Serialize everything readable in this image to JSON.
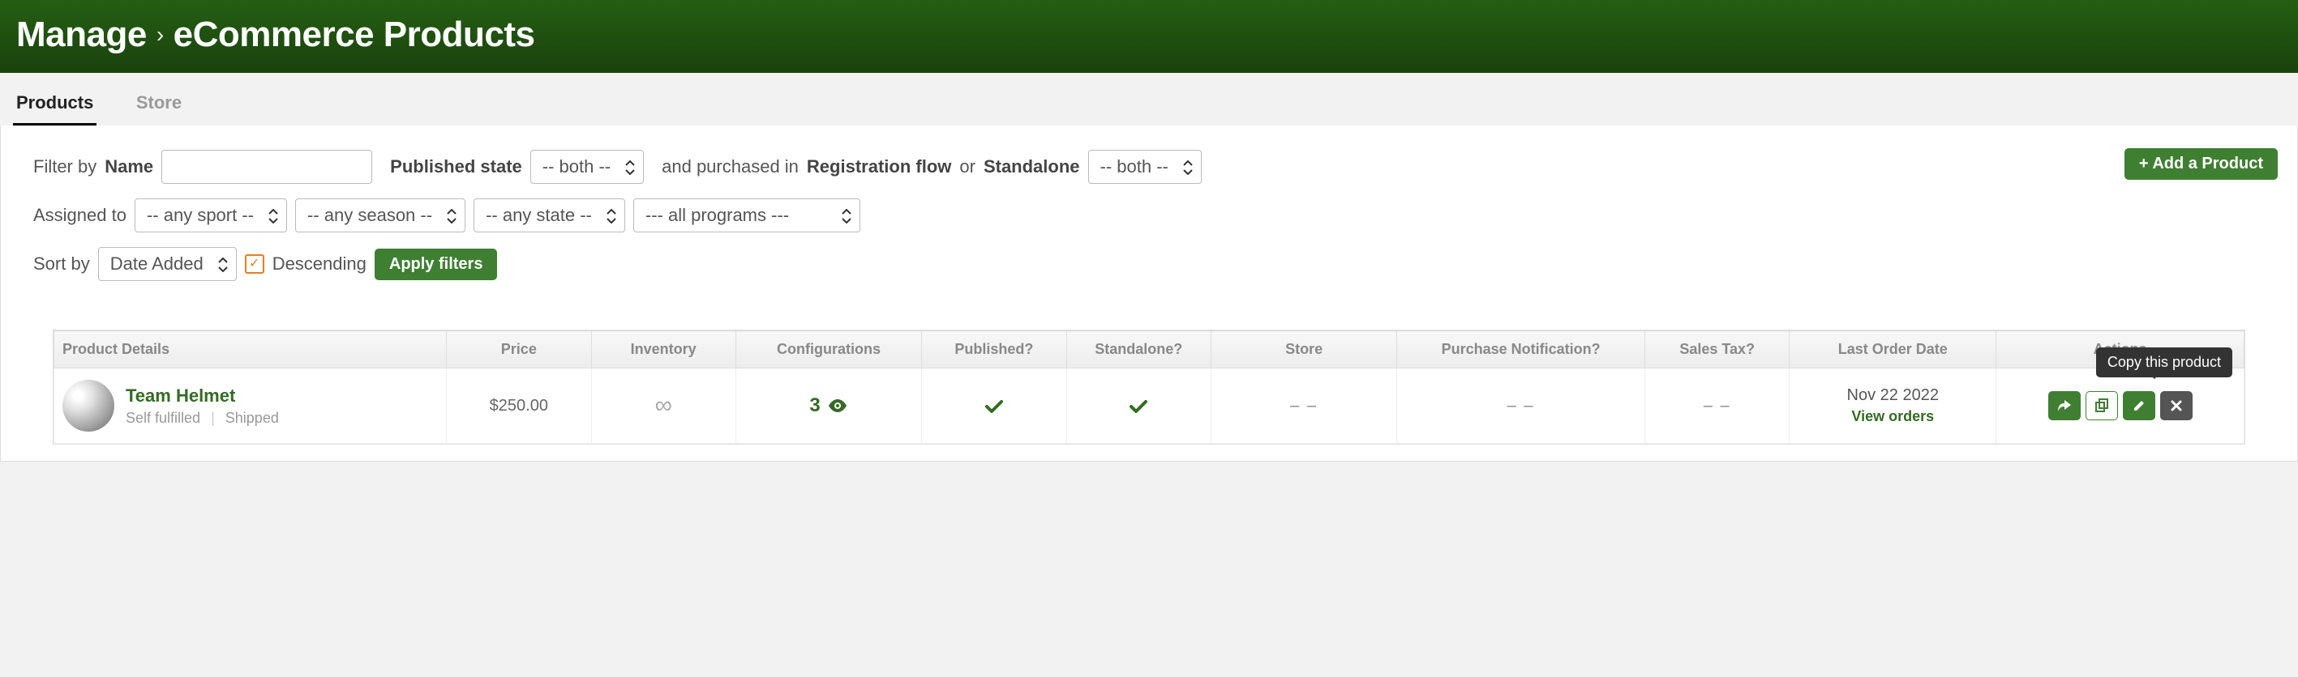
{
  "header": {
    "crumb_root": "Manage",
    "crumb_leaf": "eCommerce Products"
  },
  "tabs": [
    {
      "label": "Products",
      "active": true
    },
    {
      "label": "Store",
      "active": false
    }
  ],
  "buttons": {
    "add": "+ Add a Product",
    "apply": "Apply filters"
  },
  "filters": {
    "filterby_pre": "Filter by",
    "filterby_name": "Name",
    "pubstate_label": "Published state",
    "pubstate_value": "-- both --",
    "purchased_pre": "and purchased in",
    "purchased_reg": "Registration flow",
    "purchased_or": "or",
    "purchased_standalone": "Standalone",
    "standalone_value": "-- both --",
    "assigned_label": "Assigned to",
    "sport_value": "-- any sport --",
    "season_value": "-- any season --",
    "state_value": "-- any state --",
    "program_value": "--- all programs ---",
    "sort_label": "Sort by",
    "sort_value": "Date Added",
    "descending_label": "Descending"
  },
  "table": {
    "headers": [
      "Product Details",
      "Price",
      "Inventory",
      "Configurations",
      "Published?",
      "Standalone?",
      "Store",
      "Purchase Notification?",
      "Sales Tax?",
      "Last Order Date",
      "Actions"
    ],
    "row": {
      "name": "Team Helmet",
      "fulfillment": "Self fulfilled",
      "shipstatus": "Shipped",
      "price": "$250.00",
      "inventory": "∞",
      "configurations": "3",
      "published": true,
      "standalone": true,
      "store": "– –",
      "notification": "– –",
      "tax": "– –",
      "order_date": "Nov 22 2022",
      "order_link": "View orders"
    }
  },
  "tooltip": "Copy this product"
}
